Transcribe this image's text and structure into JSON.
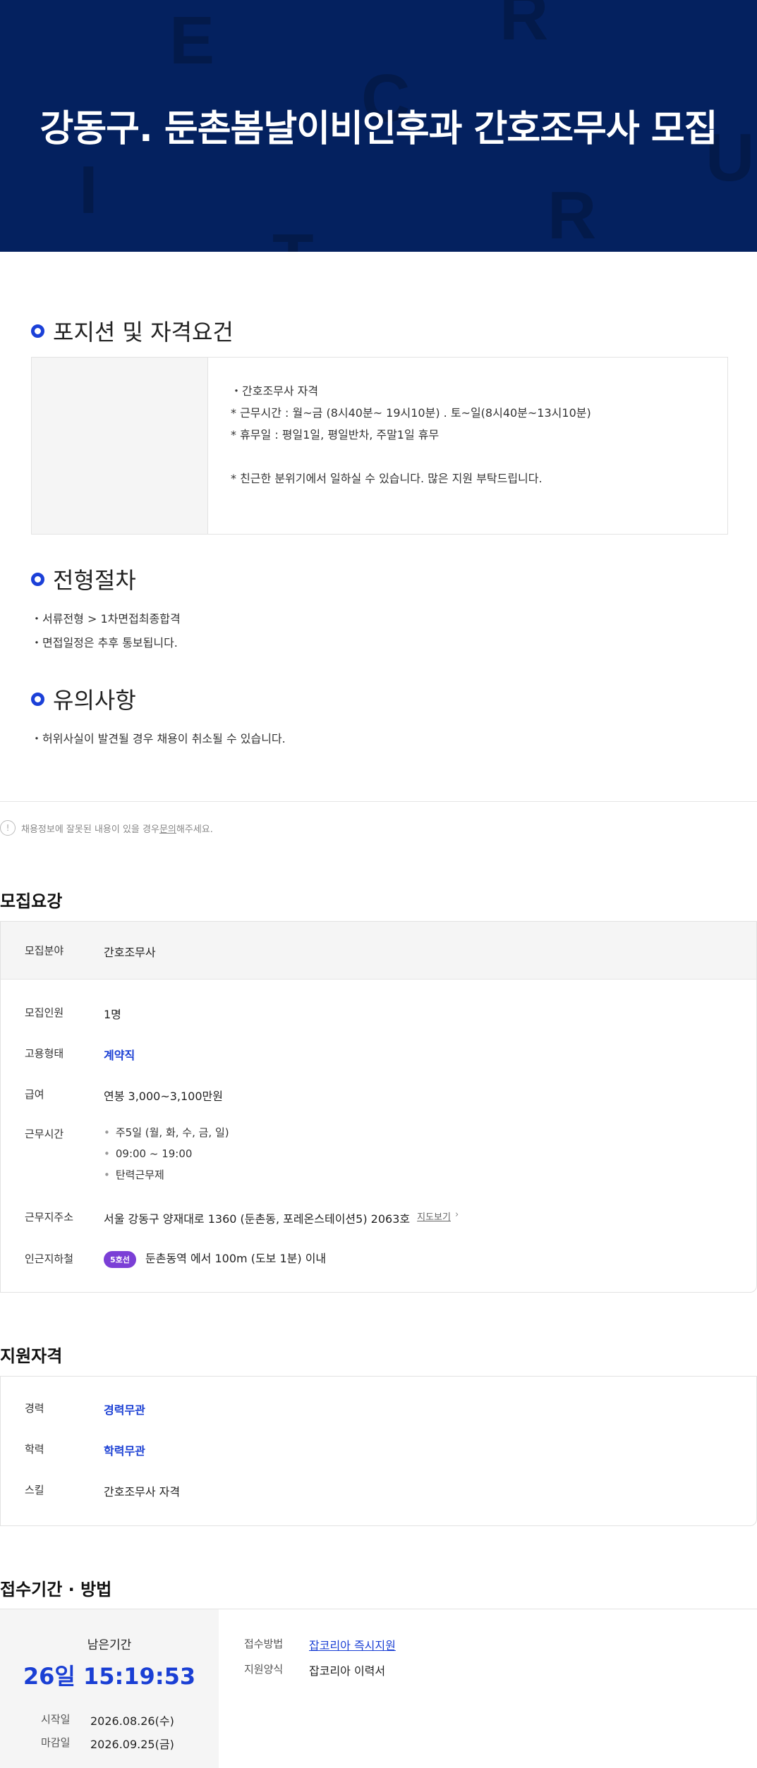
{
  "hero": {
    "title": "강동구. 둔촌봄날이비인후과 간호조무사 모집",
    "deco_letters": [
      "E",
      "R",
      "C",
      "I",
      "T",
      "R",
      "U"
    ]
  },
  "position": {
    "heading": "포지션 및 자격요건",
    "lines": [
      "・간호조무사 자격",
      "* 근무시간 : 월~금 (8시40분~ 19시10분) . 토~일(8시40분~13시10분)",
      "* 휴무일 : 평일1일, 평일반차, 주말1일 휴무",
      "",
      "* 친근한 분위기에서 일하실 수 있습니다. 많은 지원 부탁드립니다."
    ]
  },
  "process": {
    "heading": "전형절차",
    "lines": [
      "・서류전형 > 1차면접최종합격",
      "・면접일정은 추후 통보됩니다."
    ]
  },
  "caution": {
    "heading": "유의사항",
    "lines": [
      "・허위사실이 발견될 경우 채용이 취소될 수 있습니다."
    ]
  },
  "notice": {
    "icon": "info-icon",
    "before": "채용정보에 잘못된 내용이 있을 경우 ",
    "link": "문의",
    "after": "해주세요."
  },
  "recruit": {
    "heading": "모집요강",
    "field_label": "모집분야",
    "field_value": "간호조무사",
    "count_label": "모집인원",
    "count_value": "1명",
    "type_label": "고용형태",
    "type_value": "계약직",
    "salary_label": "급여",
    "salary_value": "연봉 3,000~3,100만원",
    "hours_label": "근무시간",
    "hours_items": [
      "주5일 (월, 화, 수, 금, 일)",
      "09:00 ~ 19:00",
      "탄력근무제"
    ],
    "address_label": "근무지주소",
    "address_value": "서울 강동구 양재대로 1360 (둔촌동, 포레온스테이션5) 2063호",
    "map_link": "지도보기",
    "subway_label": "인근지하철",
    "subway_line": "5호선",
    "subway_value": "둔촌동역 에서 100m (도보 1분) 이내",
    "line_color": "#7b3fd6"
  },
  "qualify": {
    "heading": "지원자격",
    "career_label": "경력",
    "career_value": "경력무관",
    "edu_label": "학력",
    "edu_value": "학력무관",
    "skill_label": "스킬",
    "skill_value": "간호조무사 자격"
  },
  "apply": {
    "heading": "접수기간 · 방법",
    "remain_label": "남은기간",
    "remain_value": "26일 15:19:53",
    "start_label": "시작일",
    "start_value": "2026.08.26(수)",
    "end_label": "마감일",
    "end_value": "2026.09.25(금)",
    "method_label": "접수방법",
    "method_value": "잡코리아 즉시지원",
    "form_label": "지원양식",
    "form_value": "잡코리아 이력서"
  },
  "colors": {
    "hero_bg": "#04215f",
    "accent": "#1a3fd4",
    "ring": "#1b40d8"
  }
}
